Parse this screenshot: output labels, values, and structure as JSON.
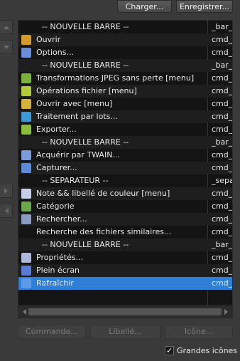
{
  "top_buttons": {
    "load": "Charger...",
    "save": "Enregistrer..."
  },
  "rows": [
    {
      "label": "-- NOUVELLE BARRE --",
      "code": "_bar_",
      "type": "sep"
    },
    {
      "label": "Ouvrir",
      "code": "cmd_",
      "icon": "open-icon",
      "color": "#d49a2a"
    },
    {
      "label": "Options...",
      "code": "cmd_",
      "icon": "gear-icon",
      "color": "#6a8fd8"
    },
    {
      "label": "-- NOUVELLE BARRE --",
      "code": "_bar_",
      "type": "sep"
    },
    {
      "label": "Transformations JPEG sans perte [menu]",
      "code": "cmd_",
      "icon": "jpeg-transform-icon",
      "color": "#7bb13a"
    },
    {
      "label": "Opérations fichier [menu]",
      "code": "cmd_",
      "icon": "file-operations-icon",
      "color": "#b4c83a"
    },
    {
      "label": "Ouvrir avec [menu]",
      "code": "cmd_",
      "icon": "open-with-icon",
      "color": "#d4b13a"
    },
    {
      "label": "Traitement par lots...",
      "code": "cmd_",
      "icon": "batch-icon",
      "color": "#3a9ad4"
    },
    {
      "label": "Exporter...",
      "code": "cmd_",
      "icon": "export-icon",
      "color": "#8bbd3a"
    },
    {
      "label": "-- NOUVELLE BARRE --",
      "code": "_bar_",
      "type": "sep"
    },
    {
      "label": "Acquérir par TWAIN...",
      "code": "cmd_",
      "icon": "scanner-icon",
      "color": "#7a9ad8"
    },
    {
      "label": "Capturer...",
      "code": "cmd_",
      "icon": "camera-icon",
      "color": "#5a8ad8"
    },
    {
      "label": "-- SEPARATEUR --",
      "code": "_sepa",
      "type": "sep"
    },
    {
      "label": "Note && libellé de couleur [menu]",
      "code": "cmd_",
      "icon": "note-icon",
      "color": "#c8d0e8"
    },
    {
      "label": "Catégorie",
      "code": "cmd_",
      "icon": "category-icon",
      "color": "#6aa84a"
    },
    {
      "label": "Rechercher...",
      "code": "cmd_",
      "icon": "binoculars-icon",
      "color": "#8a9ac0"
    },
    {
      "label": "Recherche des fichiers similaires...",
      "code": "cmd_",
      "icon": "",
      "color": ""
    },
    {
      "label": "-- NOUVELLE BARRE --",
      "code": "_bar_",
      "type": "sep"
    },
    {
      "label": "Propriétés...",
      "code": "cmd_",
      "icon": "properties-icon",
      "color": "#b0b8d8"
    },
    {
      "label": "Plein écran",
      "code": "cmd_",
      "icon": "fullscreen-icon",
      "color": "#5a7ad8"
    },
    {
      "label": "Rafraîchir",
      "code": "cmd_",
      "icon": "refresh-icon",
      "color": "#5a9ae8",
      "selected": true
    }
  ],
  "bottom_buttons": {
    "command": "Commande...",
    "label": "Libellé...",
    "icon": "Icône..."
  },
  "large_icons": {
    "label": "Grandes icônes",
    "checked": true
  }
}
